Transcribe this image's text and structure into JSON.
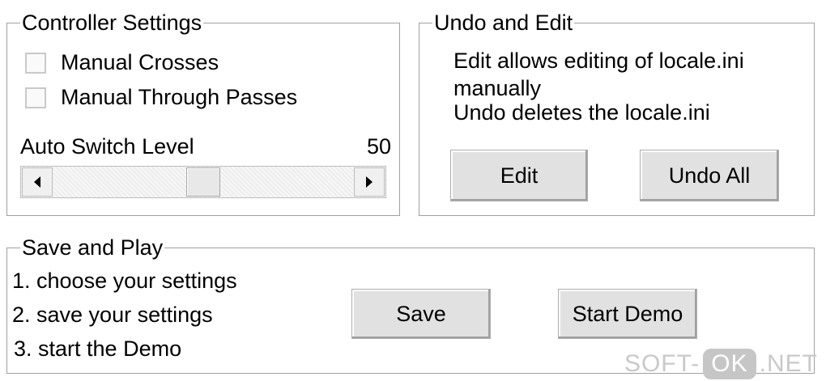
{
  "controller_settings": {
    "title": "Controller Settings",
    "manual_crosses_label": "Manual Crosses",
    "manual_through_passes_label": "Manual Through Passes",
    "auto_switch_label": "Auto Switch Level",
    "auto_switch_value": "50",
    "slider_level": 50,
    "slider_max": 100
  },
  "undo_edit": {
    "title": "Undo and Edit",
    "line1": "Edit allows editing of locale.ini",
    "line2": "manually",
    "line3": "Undo deletes the locale.ini",
    "edit_label": "Edit",
    "undo_all_label": "Undo All"
  },
  "save_play": {
    "title": "Save and Play",
    "step1": "1. choose your settings",
    "step2": "2. save your settings",
    "step3": "3. start the Demo",
    "save_label": "Save",
    "start_demo_label": "Start Demo"
  },
  "watermark": {
    "left": "SOFT-",
    "mid": "OK",
    "right": ".NET"
  }
}
